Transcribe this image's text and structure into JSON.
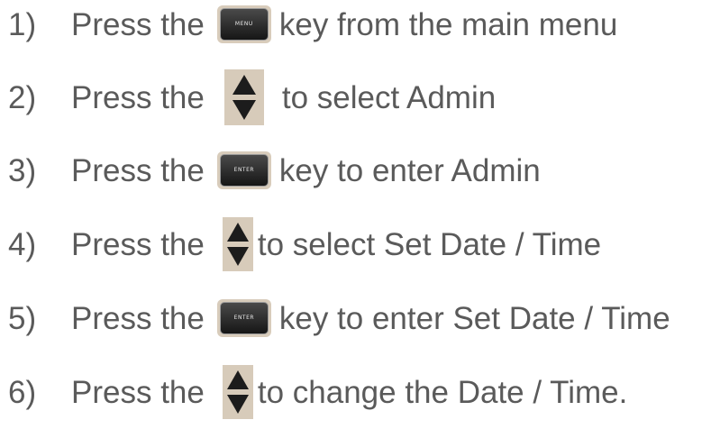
{
  "steps": [
    {
      "num": "1)",
      "press": "Press the",
      "key": "MENU",
      "key_type": "button",
      "text": "key from the main menu"
    },
    {
      "num": "2)",
      "press": "Press the",
      "key": "",
      "key_type": "arrow",
      "text": "to select Admin"
    },
    {
      "num": "3)",
      "press": "Press the",
      "key": "ENTER",
      "key_type": "button",
      "text": "key to enter Admin"
    },
    {
      "num": "4)",
      "press": "Press the",
      "key": "",
      "key_type": "arrow",
      "text": "to select Set Date / Time"
    },
    {
      "num": "5)",
      "press": "Press the",
      "key": "ENTER",
      "key_type": "button",
      "text": "key to enter Set Date / Time"
    },
    {
      "num": "6)",
      "press": "Press the",
      "key": "",
      "key_type": "arrow",
      "text": "to change the Date / Time."
    }
  ],
  "icons": {
    "menu_key": "menu-key-icon",
    "enter_key": "enter-key-icon",
    "arrow_key": "up-down-arrow-key-icon"
  },
  "colors": {
    "text": "#5a5a5a",
    "key_surround": "#d8ccbb",
    "key_face": "#1e1e1e"
  }
}
